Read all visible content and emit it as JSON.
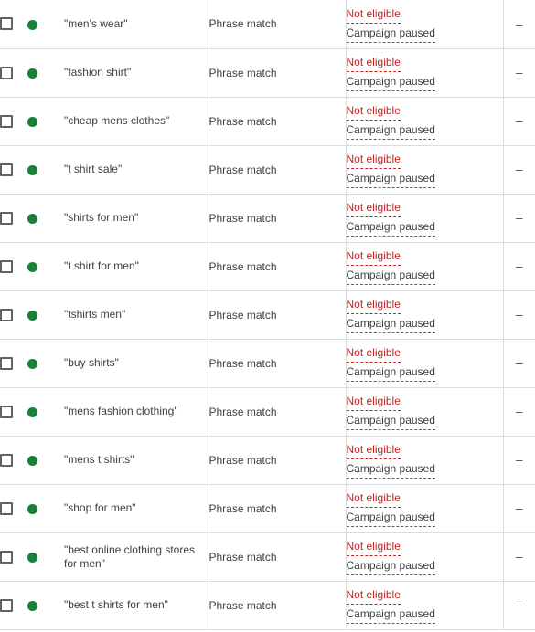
{
  "table": {
    "columns": [
      {
        "key": "select",
        "name": "row-select"
      },
      {
        "key": "status",
        "name": "ad-status"
      },
      {
        "key": "keyword",
        "name": "keyword"
      },
      {
        "key": "match_type",
        "name": "match-type"
      },
      {
        "key": "eligibility",
        "name": "eligibility-status"
      },
      {
        "key": "value",
        "name": "metric-value"
      }
    ],
    "status_dot_color": "#188038",
    "eligible_text_color": "#c5221f",
    "paused_text_color": "#3c4043",
    "border_color": "#dadce0",
    "rows": [
      {
        "keyword": "\"men's wear\"",
        "match_type": "Phrase match",
        "eligibility_primary": "Not eligible",
        "eligibility_secondary": "Campaign paused",
        "value": "–",
        "status": "enabled"
      },
      {
        "keyword": "\"fashion shirt\"",
        "match_type": "Phrase match",
        "eligibility_primary": "Not eligible",
        "eligibility_secondary": "Campaign paused",
        "value": "–",
        "status": "enabled"
      },
      {
        "keyword": "\"cheap mens clothes\"",
        "match_type": "Phrase match",
        "eligibility_primary": "Not eligible",
        "eligibility_secondary": "Campaign paused",
        "value": "–",
        "status": "enabled"
      },
      {
        "keyword": "\"t shirt sale\"",
        "match_type": "Phrase match",
        "eligibility_primary": "Not eligible",
        "eligibility_secondary": "Campaign paused",
        "value": "–",
        "status": "enabled"
      },
      {
        "keyword": "\"shirts for men\"",
        "match_type": "Phrase match",
        "eligibility_primary": "Not eligible",
        "eligibility_secondary": "Campaign paused",
        "value": "–",
        "status": "enabled"
      },
      {
        "keyword": "\"t shirt for men\"",
        "match_type": "Phrase match",
        "eligibility_primary": "Not eligible",
        "eligibility_secondary": "Campaign paused",
        "value": "–",
        "status": "enabled"
      },
      {
        "keyword": "\"tshirts men\"",
        "match_type": "Phrase match",
        "eligibility_primary": "Not eligible",
        "eligibility_secondary": "Campaign paused",
        "value": "–",
        "status": "enabled"
      },
      {
        "keyword": "\"buy shirts\"",
        "match_type": "Phrase match",
        "eligibility_primary": "Not eligible",
        "eligibility_secondary": "Campaign paused",
        "value": "–",
        "status": "enabled"
      },
      {
        "keyword": "\"mens fashion clothing\"",
        "match_type": "Phrase match",
        "eligibility_primary": "Not eligible",
        "eligibility_secondary": "Campaign paused",
        "value": "–",
        "status": "enabled"
      },
      {
        "keyword": "\"mens t shirts\"",
        "match_type": "Phrase match",
        "eligibility_primary": "Not eligible",
        "eligibility_secondary": "Campaign paused",
        "value": "–",
        "status": "enabled"
      },
      {
        "keyword": "\"shop for men\"",
        "match_type": "Phrase match",
        "eligibility_primary": "Not eligible",
        "eligibility_secondary": "Campaign paused",
        "value": "–",
        "status": "enabled"
      },
      {
        "keyword": "\"best online clothing stores for men\"",
        "match_type": "Phrase match",
        "eligibility_primary": "Not eligible",
        "eligibility_secondary": "Campaign paused",
        "value": "–",
        "status": "enabled"
      },
      {
        "keyword": "\"best t shirts for men\"",
        "match_type": "Phrase match",
        "eligibility_primary": "Not eligible",
        "eligibility_secondary": "Campaign paused",
        "value": "–",
        "status": "enabled"
      }
    ]
  }
}
